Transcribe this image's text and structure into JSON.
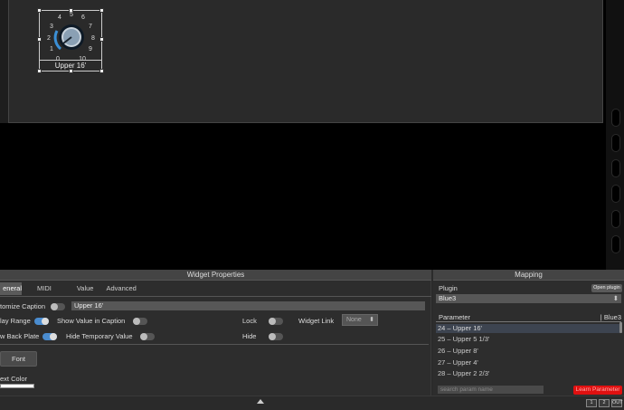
{
  "knob": {
    "caption": "Upper 16'",
    "scale": [
      "0",
      "1",
      "2",
      "3",
      "4",
      "5",
      "6",
      "7",
      "8",
      "9",
      "10"
    ]
  },
  "widget_properties": {
    "title": "Widget Properties",
    "tabs": [
      "eneral",
      "MIDI",
      "Value",
      "Advanced"
    ],
    "customize_caption_label": "tomize Caption",
    "caption_value": "Upper 16'",
    "display_range_label": "lay Range",
    "show_value_label": "Show Value in Caption",
    "lock_label": "Lock",
    "widget_link_label": "Widget Link",
    "widget_link_value": "None",
    "back_plate_label": "w Back Plate",
    "hide_temp_label": "Hide Temporary Value",
    "hide_label": "Hide",
    "font_button": "Font",
    "text_color_label": "ext Color"
  },
  "mapping": {
    "title": "Mapping",
    "plugin_label": "Plugin",
    "open_plugin": "Open plugin",
    "plugin_value": "Blue3",
    "param_header": "Parameter",
    "param_plugin": "| Blue3",
    "params": [
      "24 – Upper 16'",
      "25 – Upper 5 1/3'",
      "26 – Upper 8'",
      "27 – Upper 4'",
      "28 – Upper 2 2/3'"
    ],
    "search_placeholder": "search param name",
    "learn_button": "Learn Parameter"
  },
  "status": {
    "btn1": "1",
    "btn2": "2",
    "btn3": "OUT"
  }
}
